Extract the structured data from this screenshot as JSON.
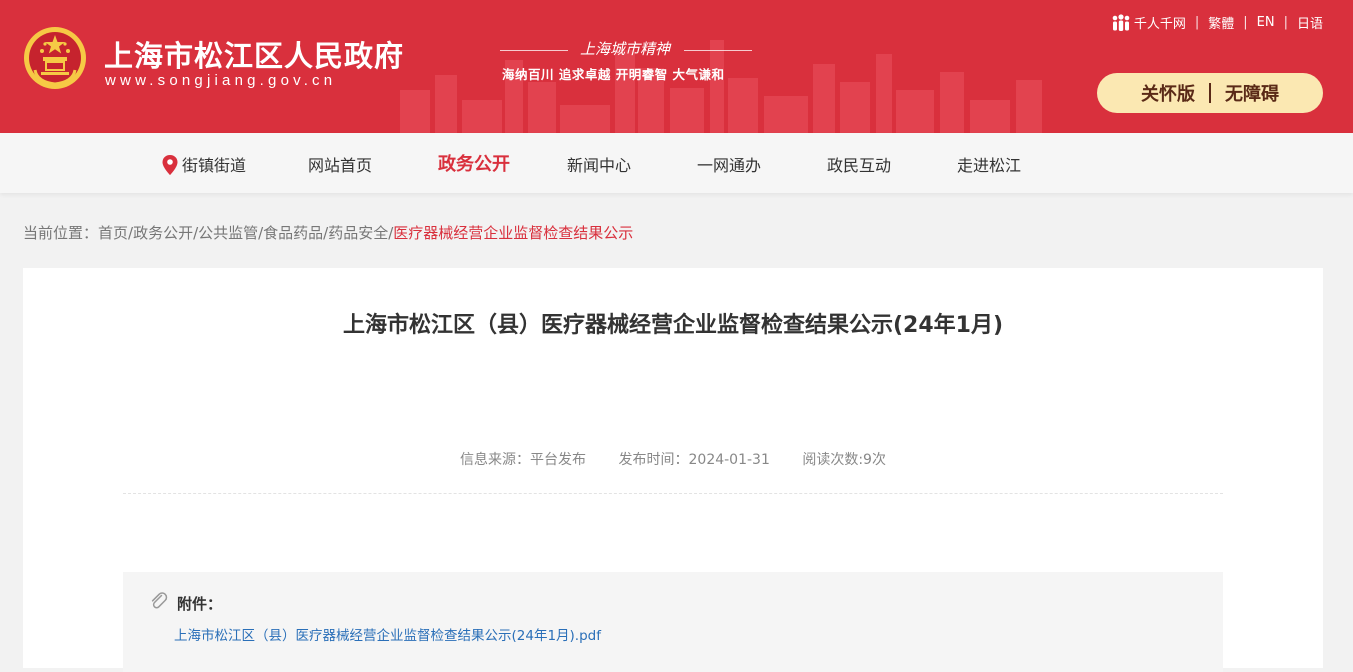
{
  "header": {
    "site_name": "上海市松江区人民政府",
    "site_domain": "www.songjiang.gov.cn",
    "spirit_title": "上海城市精神",
    "spirit_slogans": "海纳百川  追求卓越  开明睿智  大气谦和",
    "lang_links": [
      "千人千网",
      "繁體",
      "EN",
      "日语"
    ],
    "care_mode": "关怀版",
    "accessibility": "无障碍",
    "brand_color": "#d9303d"
  },
  "nav": {
    "items": [
      "街镇街道",
      "网站首页",
      "政务公开",
      "新闻中心",
      "一网通办",
      "政民互动",
      "走进松江"
    ],
    "active": "政务公开"
  },
  "breadcrumb": {
    "prefix": "当前位置：",
    "path": "首页/政务公开/公共监管/食品药品/药品安全/",
    "current": "医疗器械经营企业监督检查结果公示"
  },
  "article": {
    "title": "上海市松江区（县）医疗器械经营企业监督检查结果公示(24年1月)",
    "source": "信息来源：平台发布",
    "publish_time": "发布时间：2024-01-31",
    "views": "阅读次数:9次"
  },
  "attachment": {
    "label": "附件：",
    "file": "上海市松江区（县）医疗器械经营企业监督检查结果公示(24年1月).pdf"
  }
}
